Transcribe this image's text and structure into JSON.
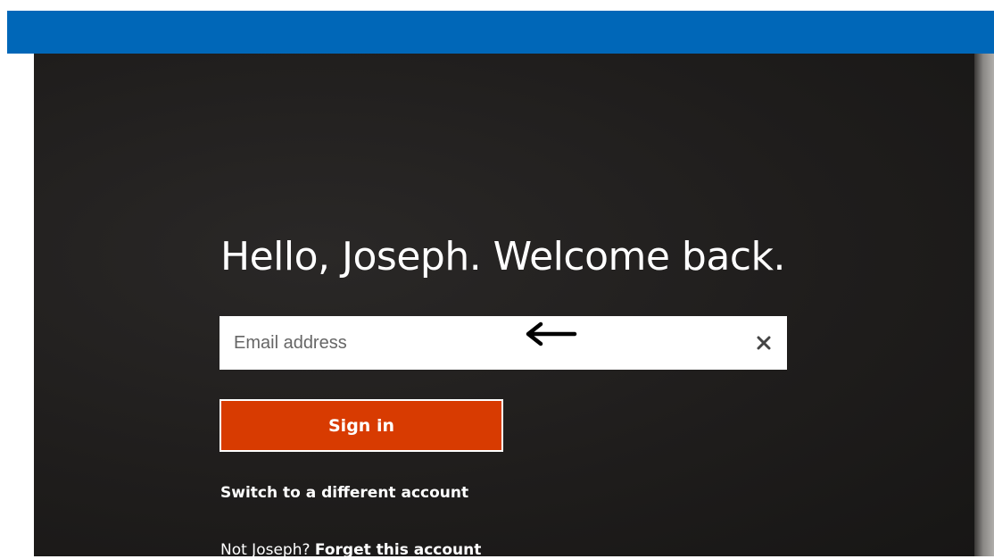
{
  "header": {
    "color": "#0067b8"
  },
  "login": {
    "greeting": "Hello, Joseph. Welcome back.",
    "email": {
      "placeholder": "Email address",
      "value": "",
      "clear_icon": "close-icon"
    },
    "annotation_icon": "arrow-left-icon",
    "sign_in_label": "Sign in",
    "switch_account_label": "Switch to a different account",
    "not_user_prefix": "Not Joseph? ",
    "forget_account_label": "Forget this account"
  },
  "colors": {
    "sign_in": "#d83b01",
    "background": "#1f1d1c",
    "text": "#ffffff"
  }
}
